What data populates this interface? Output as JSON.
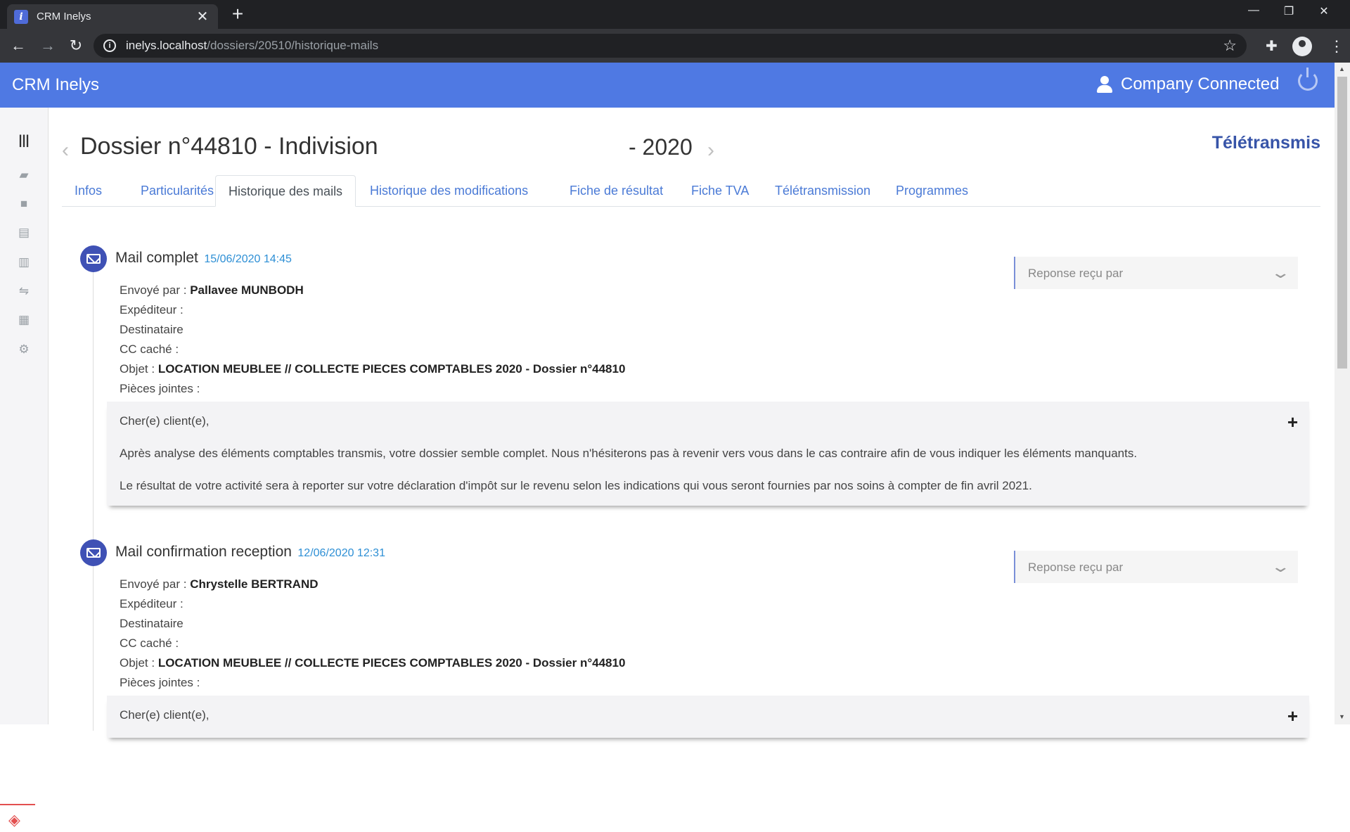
{
  "browser": {
    "tab_title": "CRM Inelys",
    "favicon_letter": "i",
    "url_host": "inelys.localhost",
    "url_path": "/dossiers/20510/historique-mails"
  },
  "app": {
    "brand": "CRM Inelys",
    "user_label": "Company Connected",
    "accent_color": "#4f79e3"
  },
  "page": {
    "dossier_title": "Dossier n°44810 - Indivision",
    "year": "- 2020",
    "teletransmis_label": "Télétransmis"
  },
  "tabs": [
    {
      "label": "Infos",
      "active": false
    },
    {
      "label": "Particularités",
      "active": false
    },
    {
      "label": "Historique des mails",
      "active": true
    },
    {
      "label": "Historique des modifications",
      "active": false
    },
    {
      "label": "Fiche de résultat",
      "active": false
    },
    {
      "label": "Fiche TVA",
      "active": false
    },
    {
      "label": "Télétransmission",
      "active": false
    },
    {
      "label": "Programmes",
      "active": false
    }
  ],
  "sidebar_icons": [
    "menu-icon",
    "folder-open-icon",
    "folder-icon",
    "file-icon",
    "building-icon",
    "handshake-icon",
    "chart-icon",
    "gear-icon"
  ],
  "mails": [
    {
      "title": "Mail complet",
      "date": "15/06/2020 14:45",
      "reponse_placeholder": "Reponse reçu par",
      "labels": {
        "sender": "Envoyé par :",
        "expediteur": "Expéditeur :",
        "destinataire": "Destinataire",
        "cc": "CC caché :",
        "objet": "Objet :",
        "pieces": "Pièces jointes :"
      },
      "sender": "Pallavee MUNBODH",
      "objet": "LOCATION MEUBLEE // COLLECTE PIECES COMPTABLES 2020 - Dossier n°44810",
      "body": [
        "Cher(e) client(e),",
        "Après analyse des éléments comptables transmis, votre dossier semble complet. Nous n'hésiterons pas à revenir vers vous dans le cas contraire afin de vous indiquer les éléments manquants.",
        "Le résultat de votre activité sera à reporter sur votre déclaration d'impôt sur le revenu selon les indications qui vous seront fournies par nos soins à compter de fin avril 2021."
      ]
    },
    {
      "title": "Mail confirmation reception",
      "date": "12/06/2020 12:31",
      "reponse_placeholder": "Reponse reçu par",
      "labels": {
        "sender": "Envoyé par :",
        "expediteur": "Expéditeur :",
        "destinataire": "Destinataire",
        "cc": "CC caché :",
        "objet": "Objet :",
        "pieces": "Pièces jointes :"
      },
      "sender": "Chrystelle BERTRAND",
      "objet": "LOCATION MEUBLEE // COLLECTE PIECES COMPTABLES 2020 - Dossier n°44810",
      "body": [
        "Cher(e) client(e),"
      ]
    }
  ]
}
